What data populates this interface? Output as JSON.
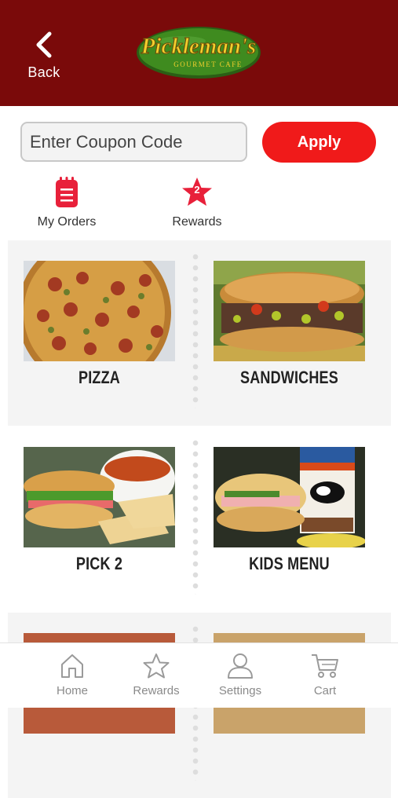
{
  "header": {
    "back_label": "Back",
    "logo_text_main": "Pickleman's",
    "logo_text_sub": "GOURMET CAFE"
  },
  "coupon": {
    "placeholder": "Enter Coupon Code",
    "apply_label": "Apply"
  },
  "quick_links": {
    "orders_label": "My Orders",
    "rewards_label": "Rewards",
    "rewards_count": "2"
  },
  "menu": {
    "items": [
      {
        "label": "PIZZA"
      },
      {
        "label": "SANDWICHES"
      },
      {
        "label": "PICK 2"
      },
      {
        "label": "KIDS MENU"
      }
    ]
  },
  "tabs": [
    {
      "label": "Home",
      "icon": "home-icon"
    },
    {
      "label": "Rewards",
      "icon": "star-icon"
    },
    {
      "label": "Settings",
      "icon": "person-icon"
    },
    {
      "label": "Cart",
      "icon": "cart-icon"
    }
  ],
  "colors": {
    "header_bg": "#7a0a0a",
    "accent_red": "#f01a1a",
    "logo_green": "#3f8b1f",
    "logo_yellow": "#f2cf2d"
  }
}
